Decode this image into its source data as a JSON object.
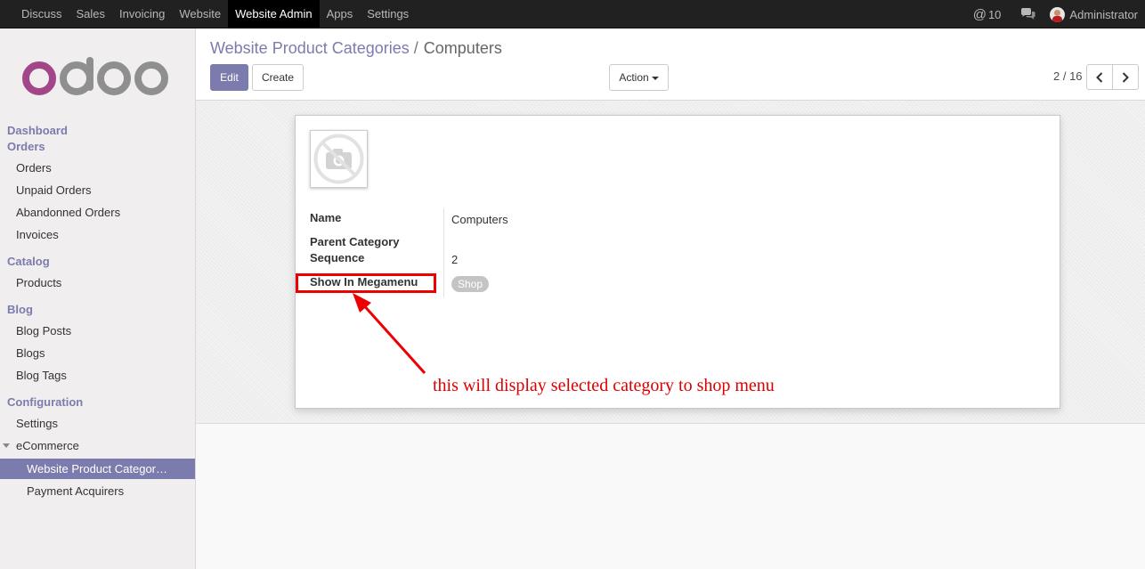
{
  "topbar": {
    "menus": [
      "Discuss",
      "Sales",
      "Invoicing",
      "Website",
      "Website Admin",
      "Apps",
      "Settings"
    ],
    "active_menu": "Website Admin",
    "mention_count": "10",
    "user_name": "Administrator"
  },
  "logo_text": "odoo",
  "sidebar": {
    "dashboard": "Dashboard",
    "orders_head": "Orders",
    "orders": [
      "Orders",
      "Unpaid Orders",
      "Abandonned Orders",
      "Invoices"
    ],
    "catalog_head": "Catalog",
    "catalog": [
      "Products"
    ],
    "blog_head": "Blog",
    "blog": [
      "Blog Posts",
      "Blogs",
      "Blog Tags"
    ],
    "config_head": "Configuration",
    "config": [
      "Settings"
    ],
    "ecommerce": "eCommerce",
    "ecommerce_items": [
      "Website Product Categor…",
      "Payment Acquirers"
    ]
  },
  "breadcrumb": {
    "parent": "Website Product Categories",
    "separator": "/",
    "current": "Computers"
  },
  "buttons": {
    "edit": "Edit",
    "create": "Create",
    "action": "Action"
  },
  "pager": "2 / 16",
  "form": {
    "labels": {
      "name": "Name",
      "parent": "Parent Category",
      "sequence": "Sequence",
      "megamenu": "Show In Megamenu"
    },
    "values": {
      "name": "Computers",
      "sequence": "2",
      "megamenu_tag": "Shop"
    }
  },
  "annotation": "this will display selected category to shop menu",
  "colors": {
    "brand": "#7c7bad",
    "annotation": "#dd0000",
    "navbar": "#212121"
  }
}
